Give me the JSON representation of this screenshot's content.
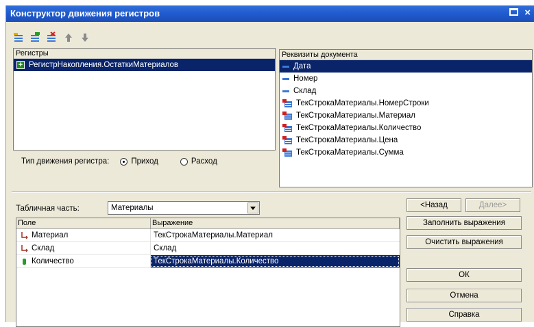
{
  "window": {
    "title": "Конструктор движения регистров"
  },
  "toolbar": {
    "icons": [
      "add-register-icon",
      "add-all-registers-icon",
      "delete-register-icon",
      "move-up-icon",
      "move-down-icon"
    ]
  },
  "registers": {
    "header": "Регистры",
    "items": [
      {
        "label": "РегистрНакопления.ОстаткиМатериалов",
        "selected": true
      }
    ]
  },
  "movement_type": {
    "label": "Тип движения регистра:",
    "options": [
      {
        "label": "Приход",
        "checked": true
      },
      {
        "label": "Расход",
        "checked": false
      }
    ]
  },
  "doc_attrs": {
    "header": "Реквизиты документа",
    "items": [
      {
        "label": "Дата",
        "icon": "attribute-icon",
        "selected": true
      },
      {
        "label": "Номер",
        "icon": "attribute-icon"
      },
      {
        "label": "Склад",
        "icon": "attribute-icon"
      },
      {
        "label": "ТекСтрокаМатериалы.НомерСтроки",
        "icon": "tabular-attribute-icon"
      },
      {
        "label": "ТекСтрокаМатериалы.Материал",
        "icon": "tabular-attribute-icon"
      },
      {
        "label": "ТекСтрокаМатериалы.Количество",
        "icon": "tabular-attribute-icon"
      },
      {
        "label": "ТекСтрокаМатериалы.Цена",
        "icon": "tabular-attribute-icon"
      },
      {
        "label": "ТекСтрокаМатериалы.Сумма",
        "icon": "tabular-attribute-icon"
      }
    ]
  },
  "tabular": {
    "label": "Табличная часть:",
    "value": "Материалы"
  },
  "fields": {
    "columns": [
      "Поле",
      "Выражение"
    ],
    "rows": [
      {
        "field": "Материал",
        "expr": "ТекСтрокаМатериалы.Материал",
        "icon": "dimension-icon"
      },
      {
        "field": "Склад",
        "expr": "Склад",
        "icon": "dimension-icon"
      },
      {
        "field": "Количество",
        "expr": "ТекСтрокаМатериалы.Количество",
        "icon": "resource-icon",
        "selected": true
      }
    ]
  },
  "buttons": {
    "back": "<Назад",
    "next": "Далее>",
    "fill": "Заполнить выражения",
    "clear": "Очистить выражения",
    "ok": "ОК",
    "cancel": "Отмена",
    "help": "Справка"
  }
}
